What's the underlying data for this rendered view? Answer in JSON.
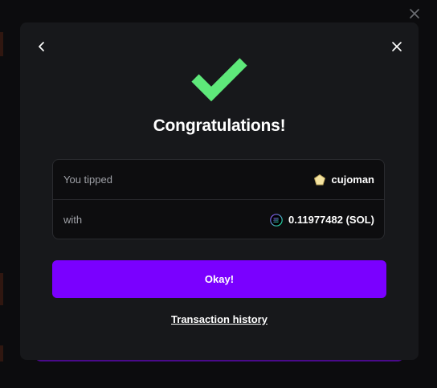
{
  "modal": {
    "title": "Congratulations!",
    "icons": {
      "back": "chevron-left-icon",
      "close": "close-icon",
      "success": "checkmark-icon",
      "recipient": "pentagon-badge-icon",
      "currency": "solana-icon"
    },
    "details": {
      "rows": [
        {
          "label": "You tipped",
          "value": "cujoman"
        },
        {
          "label": "with",
          "value": "0.11977482 (SOL)"
        }
      ]
    },
    "okay_label": "Okay!",
    "history_label": "Transaction history"
  },
  "colors": {
    "accent": "#7a00ff",
    "success": "#5ee87a",
    "modal_bg": "#17181b",
    "card_bg": "#0d0d0f"
  }
}
